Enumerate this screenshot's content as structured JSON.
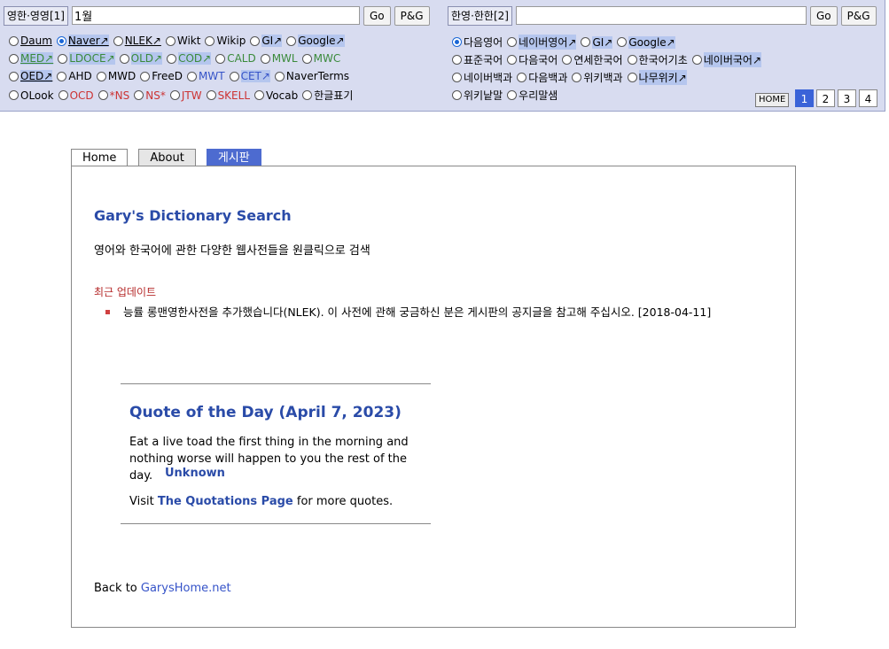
{
  "left_panel": {
    "label": "영한·영영[1]",
    "input_value": "1월",
    "go": "Go",
    "pg": "P&G",
    "rows": [
      [
        {
          "t": "Daum",
          "on": false,
          "u": true
        },
        {
          "t": "Naver↗",
          "on": true,
          "u": true,
          "hl": true
        },
        {
          "t": "NLEK↗",
          "on": false,
          "u": true
        },
        {
          "t": "Wikt",
          "on": false
        },
        {
          "t": "Wikip",
          "on": false
        },
        {
          "t": "GI↗",
          "on": false,
          "hl": true
        },
        {
          "t": "Google↗",
          "on": false,
          "hl": true
        }
      ],
      [
        {
          "t": "MED↗",
          "on": false,
          "c": "green",
          "hl": true,
          "u": true
        },
        {
          "t": "LDOCE↗",
          "on": false,
          "c": "green",
          "hl": true
        },
        {
          "t": "OLD↗",
          "on": false,
          "c": "green",
          "hl": true
        },
        {
          "t": "COD↗",
          "on": false,
          "c": "green",
          "hl": true
        },
        {
          "t": "CALD",
          "on": false,
          "c": "green"
        },
        {
          "t": "MWL",
          "on": false,
          "c": "green"
        },
        {
          "t": "MWC",
          "on": false,
          "c": "green"
        }
      ],
      [
        {
          "t": "OED↗",
          "on": false,
          "u": true,
          "hl": true
        },
        {
          "t": "AHD",
          "on": false
        },
        {
          "t": "MWD",
          "on": false
        },
        {
          "t": "FreeD",
          "on": false
        },
        {
          "t": "MWT",
          "on": false,
          "c": "blue"
        },
        {
          "t": "CET↗",
          "on": false,
          "c": "blue",
          "hl": true
        },
        {
          "t": "NaverTerms",
          "on": false
        }
      ],
      [
        {
          "t": "OLook",
          "on": false
        },
        {
          "t": "OCD",
          "on": false,
          "c": "red"
        },
        {
          "t": "*NS",
          "on": false,
          "c": "red"
        },
        {
          "t": "NS*",
          "on": false,
          "c": "red"
        },
        {
          "t": "JTW",
          "on": false,
          "c": "red"
        },
        {
          "t": "SKELL",
          "on": false,
          "c": "red"
        },
        {
          "t": "Vocab",
          "on": false
        },
        {
          "t": "한글표기",
          "on": false
        }
      ]
    ]
  },
  "right_panel": {
    "label": "한영·한한[2]",
    "input_value": "",
    "go": "Go",
    "pg": "P&G",
    "rows": [
      [
        {
          "t": "다음영어",
          "on": true
        },
        {
          "t": "네이버영어↗",
          "on": false,
          "hl": true
        },
        {
          "t": "GI↗",
          "on": false,
          "hl": true
        },
        {
          "t": "Google↗",
          "on": false,
          "hl": true
        }
      ],
      [
        {
          "t": "표준국어",
          "on": false
        },
        {
          "t": "다음국어",
          "on": false
        },
        {
          "t": "연세한국어",
          "on": false
        },
        {
          "t": "한국어기초",
          "on": false
        },
        {
          "t": "네이버국어↗",
          "on": false,
          "hl": true
        }
      ],
      [
        {
          "t": "네이버백과",
          "on": false
        },
        {
          "t": "다음백과",
          "on": false
        },
        {
          "t": "위키백과",
          "on": false
        },
        {
          "t": "나무위키↗",
          "on": false,
          "hl": true
        }
      ],
      [
        {
          "t": "위키낱말",
          "on": false
        },
        {
          "t": "우리말샘",
          "on": false
        }
      ]
    ]
  },
  "home_label": "HOME",
  "pages": [
    "1",
    "2",
    "3",
    "4"
  ],
  "tabs": {
    "home": "Home",
    "about": "About",
    "board": "게시판"
  },
  "main": {
    "title": "Gary's Dictionary Search",
    "desc": "영어와 한국어에 관한 다양한 웹사전들을 원클릭으로 검색",
    "recent": "최근 업데이트",
    "news": "능률 롱맨영한사전을 추가했습니다(NLEK). 이 사전에 관해 궁금하신 분은 게시판의 공지글을 참고해 주십시오. [2018-04-11]",
    "quote_title": "Quote of the Day (April 7, 2023)",
    "quote_text": "Eat a live toad the first thing in the morning and nothing worse will happen to you the rest of the day.",
    "quote_author": "Unknown",
    "visit_pre": "Visit ",
    "visit_link": "The Quotations Page",
    "visit_post": " for more quotes.",
    "back_pre": "Back to ",
    "back_link": "GarysHome.net"
  }
}
